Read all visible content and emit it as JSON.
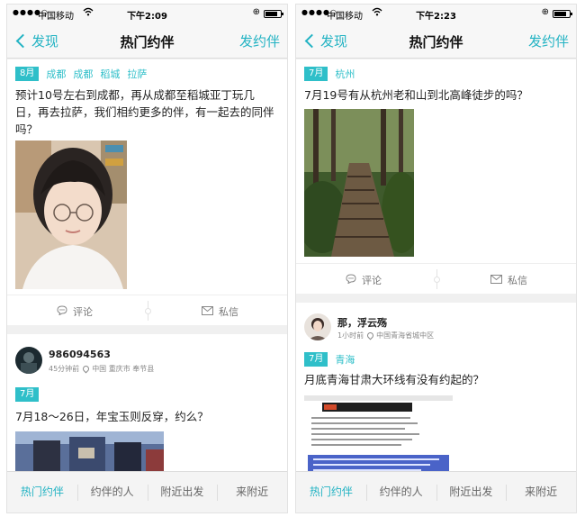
{
  "left": {
    "status": {
      "carrier": "中国移动",
      "time": "下午2:09"
    },
    "nav": {
      "back": "发现",
      "title": "热门约伴",
      "post": "发约伴"
    },
    "post1": {
      "month": "8月",
      "cities": [
        "成都",
        "成都",
        "稻城",
        "拉萨"
      ],
      "text": "预计10号左右到成都，再从成都至稻城亚丁玩几日，再去拉萨，我们相约更多的伴，有一起去的同伴吗？"
    },
    "actions": {
      "comment": "评论",
      "message": "私信"
    },
    "post2": {
      "username": "986094563",
      "time": "45分钟前",
      "location": "中国 重庆市 奉节县",
      "month": "7月",
      "text": "7月18～26日，年宝玉则反穿，约么？"
    },
    "tabs": [
      "热门约伴",
      "约伴的人",
      "附近出发",
      "来附近"
    ]
  },
  "right": {
    "status": {
      "carrier": "中国移动",
      "time": "下午2:23"
    },
    "nav": {
      "back": "发现",
      "title": "热门约伴",
      "post": "发约伴"
    },
    "post1": {
      "month": "7月",
      "city": "杭州",
      "text": "7月19号有从杭州老和山到北高峰徒步的吗？"
    },
    "actions": {
      "comment": "评论",
      "message": "私信"
    },
    "post2": {
      "username": "那，浮云殇",
      "time": "1小时前",
      "location": "中国青海省城中区",
      "month": "7月",
      "city": "青海",
      "text": "月底青海甘肃大环线有没有约起的？"
    },
    "tabs": [
      "热门约伴",
      "约伴的人",
      "附近出发",
      "来附近"
    ]
  },
  "colors": {
    "accent": "#23b3c3",
    "tag": "#2fbfc9",
    "background": "#f0f0f0"
  },
  "icons": [
    "chevron-left-icon",
    "wifi-icon",
    "battery-icon",
    "comment-icon",
    "mail-icon",
    "location-pin-icon"
  ]
}
